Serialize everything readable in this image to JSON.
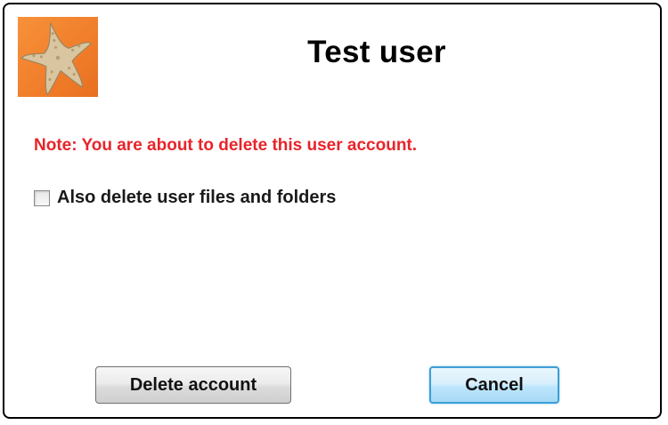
{
  "dialog": {
    "title": "Test user",
    "avatar_icon": "starfish-avatar-icon",
    "note": "Note: You are about to delete this user account.",
    "checkbox": {
      "label": "Also delete user files and folders",
      "checked": false
    },
    "buttons": {
      "delete_label": "Delete account",
      "cancel_label": "Cancel"
    }
  },
  "colors": {
    "note_text": "#e8242a",
    "avatar_background": "#f07d2a",
    "cancel_border": "#3c9fd6"
  }
}
